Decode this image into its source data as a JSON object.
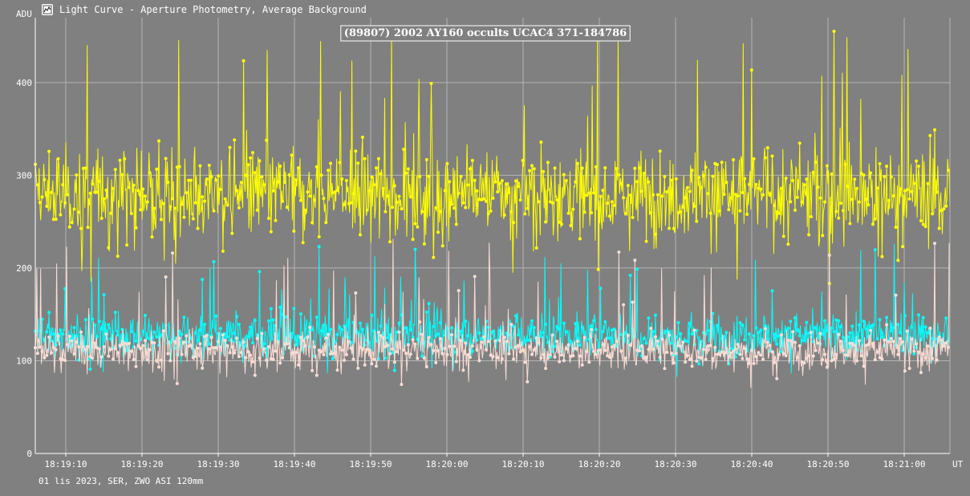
{
  "window": {
    "title": "Light Curve - Aperture Photometry, Average Background",
    "icon": "light-curve-app-icon"
  },
  "footer": {
    "info": "01 lis 2023, SER, ZWO ASI 120mm"
  },
  "chart_data": {
    "type": "line",
    "title": "(89807) 2002 AY160 occults UCAC4 371-184786",
    "ylabel": "ADU",
    "xlabel": "UT",
    "ylim": [
      0,
      470
    ],
    "y_ticks": [
      0,
      100,
      200,
      300,
      400
    ],
    "x_ticks": [
      "18:19:10",
      "18:19:20",
      "18:19:30",
      "18:19:40",
      "18:19:50",
      "18:20:00",
      "18:20:10",
      "18:20:20",
      "18:20:30",
      "18:20:40",
      "18:20:50",
      "18:21:00"
    ],
    "xlim_seconds_relative_to_first_tick": [
      -4,
      116
    ],
    "grid": true,
    "series": [
      {
        "color": "#ffff00",
        "mean": 280,
        "spread": 45,
        "spike_max": 460,
        "samples": 1200
      },
      {
        "color": "#00ffff",
        "mean": 128,
        "spread": 22,
        "spike_max": 230,
        "samples": 1200
      },
      {
        "color": "#fadcd4",
        "mean": 112,
        "spread": 20,
        "spike_max": 240,
        "samples": 1200
      }
    ]
  }
}
